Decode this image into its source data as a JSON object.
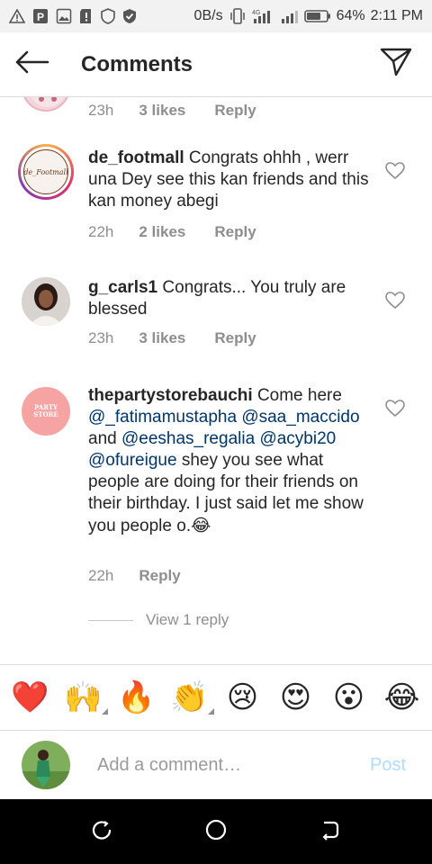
{
  "status_bar": {
    "speed": "0B/s",
    "battery": "64%",
    "time": "2:11 PM"
  },
  "header": {
    "title": "Comments",
    "back_icon": "arrow-left-icon",
    "send_icon": "paper-plane-icon"
  },
  "comments": [
    {
      "time": "23h",
      "likes": "3 likes",
      "reply": "Reply"
    },
    {
      "username": "de_footmall",
      "text": "Congrats ohhh , werr una Dey see this kan friends and this kan money abegi",
      "avatar_text": "de_Footmall",
      "time": "22h",
      "likes": "2 likes",
      "reply": "Reply"
    },
    {
      "username": "g_carls1",
      "text": "Congrats... You truly are blessed",
      "time": "23h",
      "likes": "3 likes",
      "reply": "Reply"
    },
    {
      "username": "thepartystorebauchi",
      "text_a": "Come here",
      "mention1": "@_fatimamustapha",
      "mention2": "@saa_maccido",
      "text_b": "and",
      "mention3": "@eeshas_regalia",
      "mention4": "@acybi20",
      "mention5": "@ofureigue",
      "text_c": "shey you see what people are doing for their friends on their birthday. I just said let me show you people o.",
      "emoji": "😂",
      "avatar_text": "PARTY STORE",
      "time": "22h",
      "reply": "Reply"
    }
  ],
  "view_replies": "View 1 reply",
  "emoji_bar": [
    "❤️",
    "🙌",
    "🔥",
    "👏",
    "😢",
    "😍",
    "😮",
    "😂"
  ],
  "compose": {
    "placeholder": "Add a comment…",
    "post": "Post"
  },
  "colors": {
    "mention": "#003569",
    "post_disabled": "#b3dbff",
    "meta_gray": "#8e8e8e"
  }
}
